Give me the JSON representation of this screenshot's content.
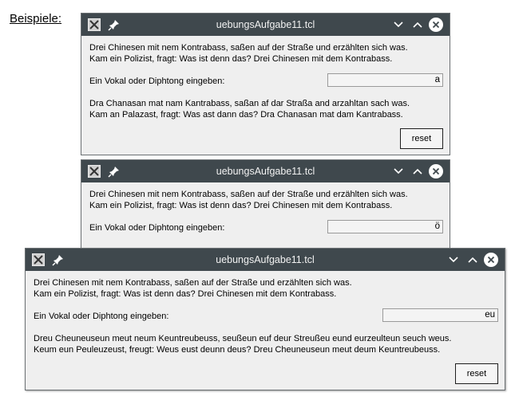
{
  "heading": "Beispiele:",
  "windows": [
    {
      "title": "uebungsAufgabe11.tcl",
      "original_line1": "Drei Chinesen mit nem Kontrabass, saßen auf der Straße und erzählten sich was.",
      "original_line2": "Kam ein Polizist, fragt: Was ist denn das? Drei Chinesen mit dem Kontrabass.",
      "prompt": "Ein Vokal oder Diphtong eingeben:",
      "entry_value": "a",
      "result_line1": "Dra Chanasan mat nam Kantrabass, saßan af dar Straßa and arzahltan sach was.",
      "result_line2": "Kam an Palazast, fragt: Was ast dann das? Dra Chanasan mat dam Kantrabass.",
      "reset_label": "reset"
    },
    {
      "title": "uebungsAufgabe11.tcl",
      "original_line1": "Drei Chinesen mit nem Kontrabass, saßen auf der Straße und erzählten sich was.",
      "original_line2": "Kam ein Polizist, fragt: Was ist denn das? Drei Chinesen mit dem Kontrabass.",
      "prompt": "Ein Vokal oder Diphtong eingeben:",
      "entry_value": "ö"
    },
    {
      "title": "uebungsAufgabe11.tcl",
      "original_line1": "Drei Chinesen mit nem Kontrabass, saßen auf der Straße und erzählten sich was.",
      "original_line2": "Kam ein Polizist, fragt: Was ist denn das? Drei Chinesen mit dem Kontrabass.",
      "prompt": "Ein Vokal oder Diphtong eingeben:",
      "entry_value": "eu",
      "result_line1": "Dreu Cheuneuseun meut neum Keuntreubeuss, seußeun euf deur Streußeu eund eurzeulteun seuch weus.",
      "result_line2": "Keum eun Peuleuzeust, freugt: Weus eust deunn deus? Dreu Cheuneuseun meut deum Keuntreubeuss.",
      "reset_label": "reset"
    }
  ]
}
